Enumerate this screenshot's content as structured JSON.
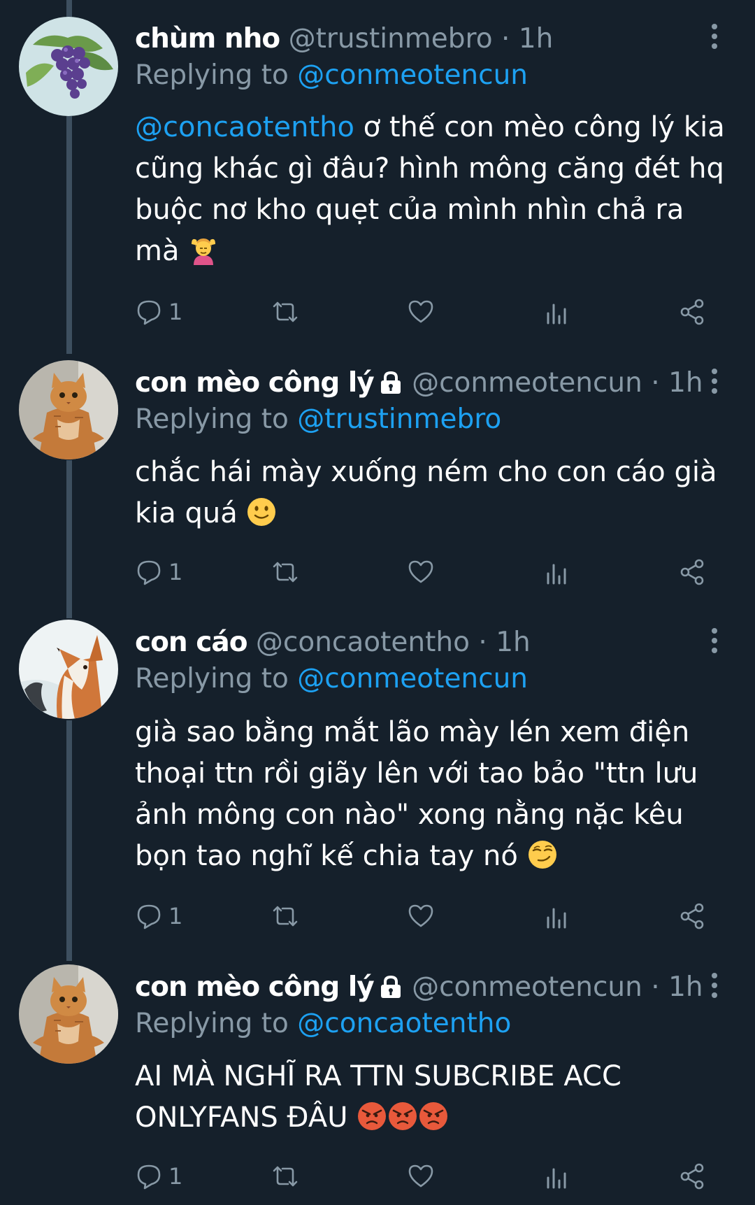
{
  "tweets": [
    {
      "name": "chùm nho",
      "handle": "@trustinmebro",
      "time": "1h",
      "replying_prefix": "Replying to",
      "replying_to": "@conmeotencun",
      "mention": "@concaotentho",
      "text": "ơ thế con mèo công lý kia cũng khác gì đâu? hình mông căng đét hq buộc nơ kho quẹt của mình nhìn chả ra mà",
      "emoji": "woman-getting-massage",
      "reply_count": "1",
      "locked": false,
      "avatar": "grapes-avatar"
    },
    {
      "name": "con mèo công lý",
      "handle": "@conmeotencun",
      "time": "1h",
      "replying_prefix": "Replying to",
      "replying_to": "@trustinmebro",
      "mention": "",
      "text": "chắc hái mày xuống ném cho con cáo già kia quá",
      "emoji": "slightly-smiling-face",
      "reply_count": "1",
      "locked": true,
      "avatar": "cat-avatar"
    },
    {
      "name": "con cáo",
      "handle": "@concaotentho",
      "time": "1h",
      "replying_prefix": "Replying to",
      "replying_to": "@conmeotencun",
      "mention": "",
      "text": "già sao bằng mắt lão mày lén xem điện thoại ttn rồi giãy lên với tao bảo \"ttn lưu ảnh mông con nào\" xong nằng nặc kêu bọn tao nghĩ kế chia tay nó",
      "emoji": "smirking-face",
      "reply_count": "1",
      "locked": false,
      "avatar": "fox-avatar"
    },
    {
      "name": "con mèo công lý",
      "handle": "@conmeotencun",
      "time": "1h",
      "replying_prefix": "Replying to",
      "replying_to": "@concaotentho",
      "mention": "",
      "text": "AI MÀ NGHĨ RA TTN SUBCRIBE ACC ONLYFANS ĐÂU",
      "emoji": "angry-face x3",
      "reply_count": "1",
      "locked": true,
      "avatar": "cat-avatar"
    }
  ],
  "separator": "·",
  "colors": {
    "background": "#15202b",
    "text": "#ffffff",
    "secondary": "#8899a6",
    "accent": "#1da1f2",
    "thread_line": "#3d4f5f"
  },
  "icons": [
    "reply-icon",
    "retweet-icon",
    "like-icon",
    "analytics-icon",
    "share-icon",
    "more-icon",
    "lock-icon"
  ]
}
